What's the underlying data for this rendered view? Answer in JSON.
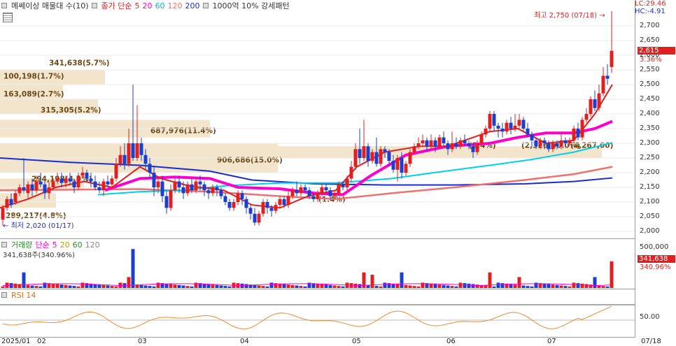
{
  "price_legend": {
    "title": "메쎄이상 매물대 수(10)",
    "ma_prefix": "종가 단순",
    "ma5": "5",
    "ma20": "20",
    "ma60": "60",
    "ma120": "120",
    "ma200": "200",
    "pattern": "1000억 10% 강세패턴"
  },
  "high_label": "최고 2,750 (07/18)",
  "low_label": "최저 2,020 (01/17)",
  "lc_label": "LC:29.46",
  "hc_label": "HC:-4.91",
  "price_axis_ticks": [
    "2,700",
    "2,650",
    "2,600",
    "2,550",
    "2,500",
    "2,450",
    "2,400",
    "2,350",
    "2,300",
    "2,250",
    "2,200",
    "2,150",
    "2,100",
    "2,050",
    "2,000"
  ],
  "current_price": "2,615",
  "current_change": "3.36%",
  "profile_labels": [
    "341,638(5.7%)",
    "100,198(1.7%)",
    "163,089(2.7%)",
    "315,305(5.2%)",
    "687,976(11.4%)",
    "906,686(15.0%)",
    "294,198(4.9%)",
    "289,217(4.8%)",
    "(1.4%)",
    "(2.4%)",
    "(2,326(00.0%)",
    "(4,267,00)"
  ],
  "volume_legend": {
    "prefix": "거래량",
    "ma_prefix": "단순",
    "ma5": "5",
    "ma20": "20",
    "ma60": "60",
    "ma120": "120",
    "readout": "341,638주(340.96%)"
  },
  "volume_axis_ticks": [
    "500,000"
  ],
  "current_volume": "341,638",
  "current_volume_pct": "340.96%",
  "rsi_legend": {
    "label": "RSI 14"
  },
  "rsi_axis_ticks": [
    "50.00"
  ],
  "x_axis_labels": [
    "2025/01",
    "02",
    "03",
    "04",
    "05",
    "06",
    "07",
    "07/18"
  ],
  "colors": {
    "up": "#e02020",
    "down": "#1a3fd0",
    "ma5": "#e02020",
    "ma20": "#ff00cc",
    "ma60": "#00d0e8",
    "ma120": "#f07070",
    "ma200": "#1a2bd0",
    "profile": "#f3e4cc"
  },
  "chart_data": {
    "type": "candlestick",
    "period": "2025/01 - 2025/07/18",
    "high": {
      "value": 2750,
      "date": "07/18"
    },
    "low": {
      "value": 2020,
      "date": "01/17"
    },
    "last_close": 2615,
    "last_change_pct": 3.36,
    "last_volume": 341638,
    "ylim": [
      1990,
      2760
    ],
    "volume_ylim": [
      0,
      520000
    ],
    "rsi_reference": 50
  }
}
